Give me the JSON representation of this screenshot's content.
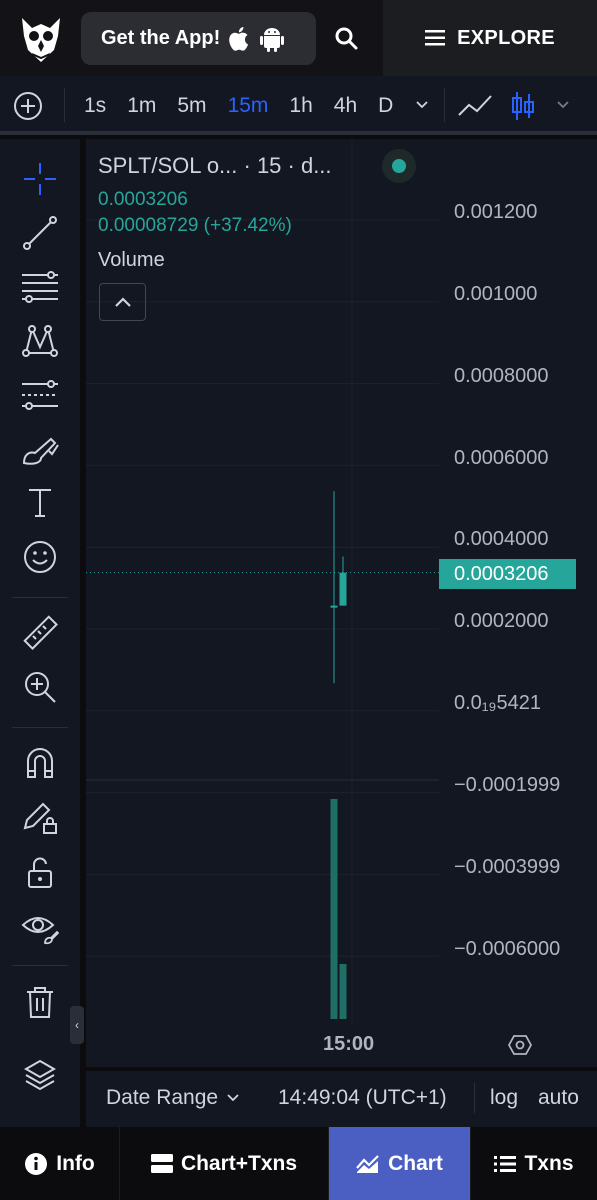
{
  "header": {
    "get_app_label": "Get the App!",
    "explore_label": "EXPLORE"
  },
  "toolbar": {
    "intervals": [
      "1s",
      "1m",
      "5m",
      "15m",
      "1h",
      "4h",
      "D"
    ],
    "active_interval": "15m"
  },
  "legend": {
    "pair": "SPLT/SOL o... · 15 · d...",
    "price": "0.0003206",
    "change": "0.00008729 (+37.42%)",
    "volume_label": "Volume"
  },
  "price_axis": {
    "labels": [
      "0.001200",
      "0.001000",
      "0.0008000",
      "0.0006000",
      "0.0004000",
      "0.0002000",
      "0.0₁₉5421",
      "−0.0001999",
      "−0.0003999",
      "−0.0006000"
    ],
    "current_price": "0.0003206"
  },
  "time_axis": {
    "label": "15:00"
  },
  "bottom_bar": {
    "date_range_label": "Date Range",
    "clock": "14:49:04 (UTC+1)",
    "log_label": "log",
    "auto_label": "auto"
  },
  "nav": {
    "tabs": [
      "Info",
      "Chart+Txns",
      "Chart",
      "Txns"
    ],
    "active": "Chart"
  },
  "colors": {
    "up": "#26a69a",
    "accent": "#2962ff",
    "nav_active": "#4a5fc1"
  },
  "chart_data": {
    "type": "candlestick",
    "interval": "15m",
    "candles": [
      {
        "open": 0.00024,
        "high": 0.00052,
        "low": 5e-05,
        "close": 0.00024,
        "volume_level": 1.0
      },
      {
        "open": 0.00024,
        "high": 0.00036,
        "low": 0.00024,
        "close": 0.0003206,
        "volume_level": 0.25
      }
    ],
    "ylim": [
      -0.0007,
      0.0013
    ]
  }
}
